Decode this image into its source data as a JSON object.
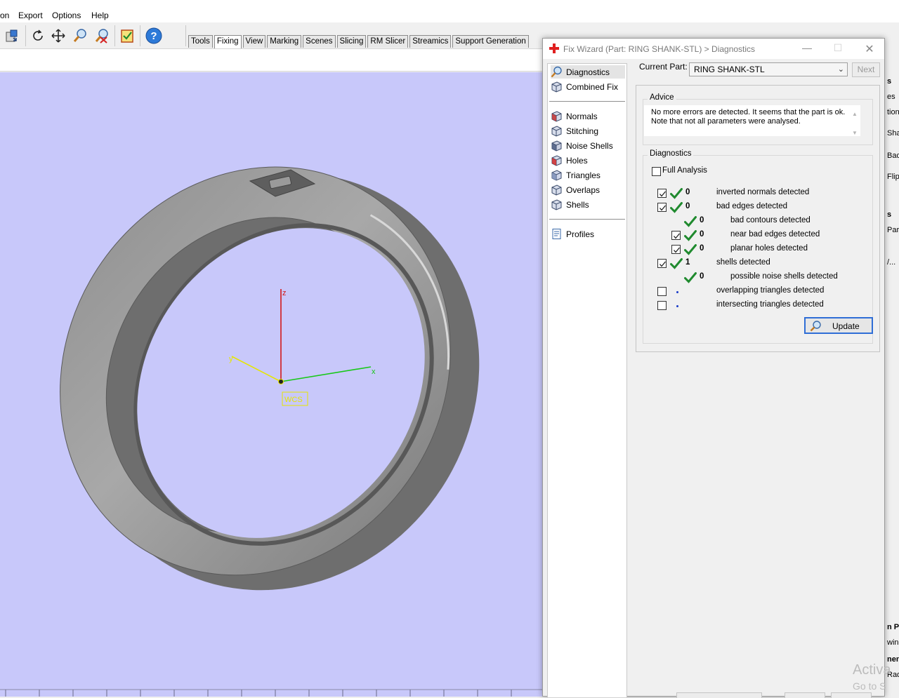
{
  "menu": [
    "on",
    "Export",
    "Options",
    "Help"
  ],
  "tabs": [
    {
      "label": "Tools",
      "active": false
    },
    {
      "label": "Fixing",
      "active": true
    },
    {
      "label": "View",
      "active": false
    },
    {
      "label": "Marking",
      "active": false
    },
    {
      "label": "Scenes",
      "active": false
    },
    {
      "label": "Slicing",
      "active": false
    },
    {
      "label": "RM Slicer",
      "active": false
    },
    {
      "label": "Streamics",
      "active": false
    },
    {
      "label": "Support Generation",
      "active": false
    }
  ],
  "toolbar_icons": [
    "import-icon",
    "rotate-icon",
    "pan-icon",
    "zoom-icon",
    "zoom-fit-icon",
    "checklist-icon",
    "help-icon"
  ],
  "viewport": {
    "background": "#c8c8fa",
    "axes": {
      "z": "z",
      "x": "x",
      "y": "y",
      "label": "WCS"
    }
  },
  "dialog": {
    "title": "Fix Wizard (Part: RING SHANK-STL) > Diagnostics",
    "nav_group1": [
      {
        "label": "Diagnostics",
        "icon": "magnifier-icon",
        "selected": true
      },
      {
        "label": "Combined Fix",
        "icon": "cube-icon",
        "selected": false
      }
    ],
    "nav_group2": [
      {
        "label": "Normals",
        "icon": "normals-cube-icon"
      },
      {
        "label": "Stitching",
        "icon": "stitching-cube-icon"
      },
      {
        "label": "Noise Shells",
        "icon": "noise-shells-icon"
      },
      {
        "label": "Holes",
        "icon": "holes-cube-icon"
      },
      {
        "label": "Triangles",
        "icon": "triangles-cube-icon"
      },
      {
        "label": "Overlaps",
        "icon": "overlaps-cube-icon"
      },
      {
        "label": "Shells",
        "icon": "shells-cube-icon"
      }
    ],
    "nav_group3": [
      {
        "label": "Profiles",
        "icon": "profiles-icon"
      }
    ],
    "current_part_label": "Current Part:",
    "current_part_value": "RING SHANK-STL",
    "next_label": "Next",
    "advice_title": "Advice",
    "advice_text_1": "No more errors are detected. It seems that the part is ok.",
    "advice_text_2": "Note that not all parameters were analysed.",
    "diagnostics_title": "Diagnostics",
    "full_analysis_label": "Full Analysis",
    "full_analysis_checked": false,
    "rows": [
      {
        "label": "inverted normals detected",
        "count": "0",
        "checkbox": true,
        "checked": true,
        "status": "ok",
        "indent": 0
      },
      {
        "label": "bad edges detected",
        "count": "0",
        "checkbox": true,
        "checked": true,
        "status": "ok",
        "indent": 0
      },
      {
        "label": "bad contours detected",
        "count": "0",
        "checkbox": false,
        "checked": false,
        "status": "ok",
        "indent": 1
      },
      {
        "label": "near bad edges detected",
        "count": "0",
        "checkbox": true,
        "checked": true,
        "status": "ok",
        "indent": 1
      },
      {
        "label": "planar holes detected",
        "count": "0",
        "checkbox": true,
        "checked": true,
        "status": "ok",
        "indent": 1
      },
      {
        "label": "shells detected",
        "count": "1",
        "checkbox": true,
        "checked": true,
        "status": "ok",
        "indent": 0
      },
      {
        "label": "possible noise shells detected",
        "count": "0",
        "checkbox": false,
        "checked": false,
        "status": "ok",
        "indent": 1
      },
      {
        "label": "overlapping triangles detected",
        "count": "",
        "checkbox": true,
        "checked": false,
        "status": "pending",
        "indent": 0
      },
      {
        "label": "intersecting triangles detected",
        "count": "",
        "checkbox": true,
        "checked": false,
        "status": "pending",
        "indent": 0
      }
    ],
    "update_label": "Update"
  },
  "right_panel_fragments": [
    "s",
    "es",
    "tion",
    "Sha",
    "Bad",
    "Flip",
    "s",
    "Part",
    "/...",
    "n Pa",
    "wing",
    "nent",
    "Rad"
  ],
  "watermark": {
    "line1": "Activa",
    "line2": "Go to S"
  },
  "colors": {
    "check": "#1f8a2e",
    "accent": "#2f6ed6",
    "z_axis": "#d21818",
    "x_axis": "#18c818",
    "y_axis": "#e6e600"
  }
}
